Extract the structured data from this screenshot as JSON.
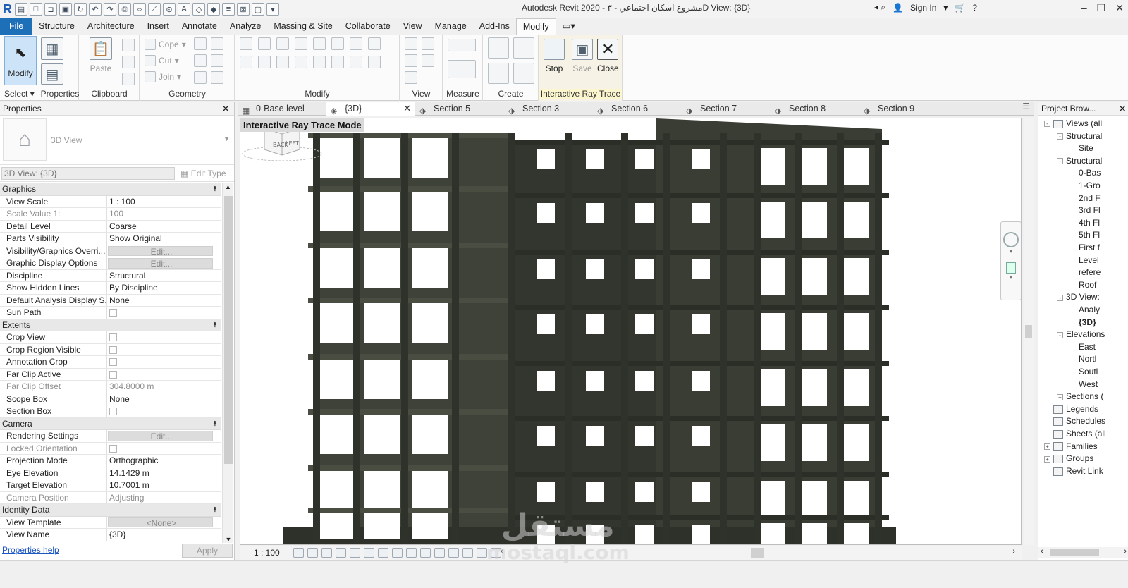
{
  "window": {
    "title": "Autodesk Revit 2020 - مشروع اسكان اجتماعي - ٣D View: {3D}",
    "sign_in": "Sign In",
    "help": "?"
  },
  "ribbon_tabs": [
    "File",
    "Structure",
    "Architecture",
    "Insert",
    "Annotate",
    "Analyze",
    "Massing & Site",
    "Collaborate",
    "View",
    "Manage",
    "Add-Ins",
    "Modify"
  ],
  "ribbon": {
    "modify": "Modify",
    "select": "Select",
    "properties": "Properties",
    "paste": "Paste",
    "clipboard": "Clipboard",
    "cope": "Cope",
    "cut": "Cut",
    "join": "Join",
    "geometry": "Geometry",
    "modify_panel": "Modify",
    "view": "View",
    "measure": "Measure",
    "create": "Create",
    "stop": "Stop",
    "save": "Save",
    "close": "Close",
    "interactive_ray_trace": "Interactive Ray Trace"
  },
  "properties": {
    "title": "Properties",
    "type_name": "3D View",
    "instance": "3D View: {3D}",
    "edit_type": "Edit Type",
    "help": "Properties help",
    "apply": "Apply",
    "groups": [
      {
        "name": "Graphics",
        "rows": [
          {
            "name": "View Scale",
            "value": "1 : 100"
          },
          {
            "name": "Scale Value    1:",
            "value": "100",
            "dim": true
          },
          {
            "name": "Detail Level",
            "value": "Coarse"
          },
          {
            "name": "Parts Visibility",
            "value": "Show Original"
          },
          {
            "name": "Visibility/Graphics Overri...",
            "value": "Edit...",
            "button": true
          },
          {
            "name": "Graphic Display Options",
            "value": "Edit...",
            "button": true
          },
          {
            "name": "Discipline",
            "value": "Structural"
          },
          {
            "name": "Show Hidden Lines",
            "value": "By Discipline"
          },
          {
            "name": "Default Analysis Display S...",
            "value": "None"
          },
          {
            "name": "Sun Path",
            "value": "",
            "checkbox": true
          }
        ]
      },
      {
        "name": "Extents",
        "rows": [
          {
            "name": "Crop View",
            "value": "",
            "checkbox": true
          },
          {
            "name": "Crop Region Visible",
            "value": "",
            "checkbox": true
          },
          {
            "name": "Annotation Crop",
            "value": "",
            "checkbox": true
          },
          {
            "name": "Far Clip Active",
            "value": "",
            "checkbox": true
          },
          {
            "name": "Far Clip Offset",
            "value": "304.8000 m",
            "dim": true
          },
          {
            "name": "Scope Box",
            "value": "None"
          },
          {
            "name": "Section Box",
            "value": "",
            "checkbox": true
          }
        ]
      },
      {
        "name": "Camera",
        "rows": [
          {
            "name": "Rendering Settings",
            "value": "Edit...",
            "button": true
          },
          {
            "name": "Locked Orientation",
            "value": "",
            "checkbox": true,
            "dim": true
          },
          {
            "name": "Projection Mode",
            "value": "Orthographic"
          },
          {
            "name": "Eye Elevation",
            "value": "14.1429 m"
          },
          {
            "name": "Target Elevation",
            "value": "10.7001 m"
          },
          {
            "name": "Camera Position",
            "value": "Adjusting",
            "dim": true
          }
        ]
      },
      {
        "name": "Identity Data",
        "rows": [
          {
            "name": "View Template",
            "value": "<None>",
            "button": true
          },
          {
            "name": "View Name",
            "value": "{3D}"
          }
        ]
      }
    ]
  },
  "view_tabs": [
    {
      "label": "0-Base level",
      "active": false
    },
    {
      "label": "{3D}",
      "active": true
    },
    {
      "label": "Section 5",
      "active": false
    },
    {
      "label": "Section 3",
      "active": false
    },
    {
      "label": "Section 6",
      "active": false
    },
    {
      "label": "Section 7",
      "active": false
    },
    {
      "label": "Section 8",
      "active": false
    },
    {
      "label": "Section 9",
      "active": false
    }
  ],
  "canvas": {
    "banner": "Interactive Ray Trace Mode",
    "viewcube_back": "BACK",
    "viewcube_left": "LEFT"
  },
  "view_control": {
    "scale": "1 : 100"
  },
  "browser": {
    "title": "Project Brow...",
    "nodes": [
      {
        "label": "Views (all",
        "level": 0,
        "toggle": "-"
      },
      {
        "label": "Structural",
        "level": 1,
        "toggle": "-"
      },
      {
        "label": "Site",
        "level": 2
      },
      {
        "label": "Structural",
        "level": 1,
        "toggle": "-"
      },
      {
        "label": "0-Bas",
        "level": 2
      },
      {
        "label": "1-Gro",
        "level": 2
      },
      {
        "label": "2nd F",
        "level": 2
      },
      {
        "label": "3rd Fl",
        "level": 2
      },
      {
        "label": "4th Fl",
        "level": 2
      },
      {
        "label": "5th Fl",
        "level": 2
      },
      {
        "label": "First f",
        "level": 2
      },
      {
        "label": "Level",
        "level": 2
      },
      {
        "label": "refere",
        "level": 2
      },
      {
        "label": "Roof",
        "level": 2
      },
      {
        "label": "3D View:",
        "level": 1,
        "toggle": "-"
      },
      {
        "label": "Analy",
        "level": 2
      },
      {
        "label": "{3D}",
        "level": 2,
        "bold": true
      },
      {
        "label": "Elevations",
        "level": 1,
        "toggle": "-"
      },
      {
        "label": "East",
        "level": 2
      },
      {
        "label": "Nortl",
        "level": 2
      },
      {
        "label": "Soutl",
        "level": 2
      },
      {
        "label": "West",
        "level": 2
      },
      {
        "label": "Sections (",
        "level": 1,
        "toggle": "+"
      },
      {
        "label": "Legends",
        "level": 0,
        "icon": true
      },
      {
        "label": "Schedules",
        "level": 0,
        "icon": true
      },
      {
        "label": "Sheets (all",
        "level": 0,
        "icon": true
      },
      {
        "label": "Families",
        "level": 0,
        "toggle": "+",
        "icon": true
      },
      {
        "label": "Groups",
        "level": 0,
        "toggle": "+",
        "icon": true
      },
      {
        "label": "Revit Link",
        "level": 0,
        "icon": true
      }
    ]
  },
  "watermark": {
    "main": "مستقل",
    "sub": "mostaql.com"
  }
}
